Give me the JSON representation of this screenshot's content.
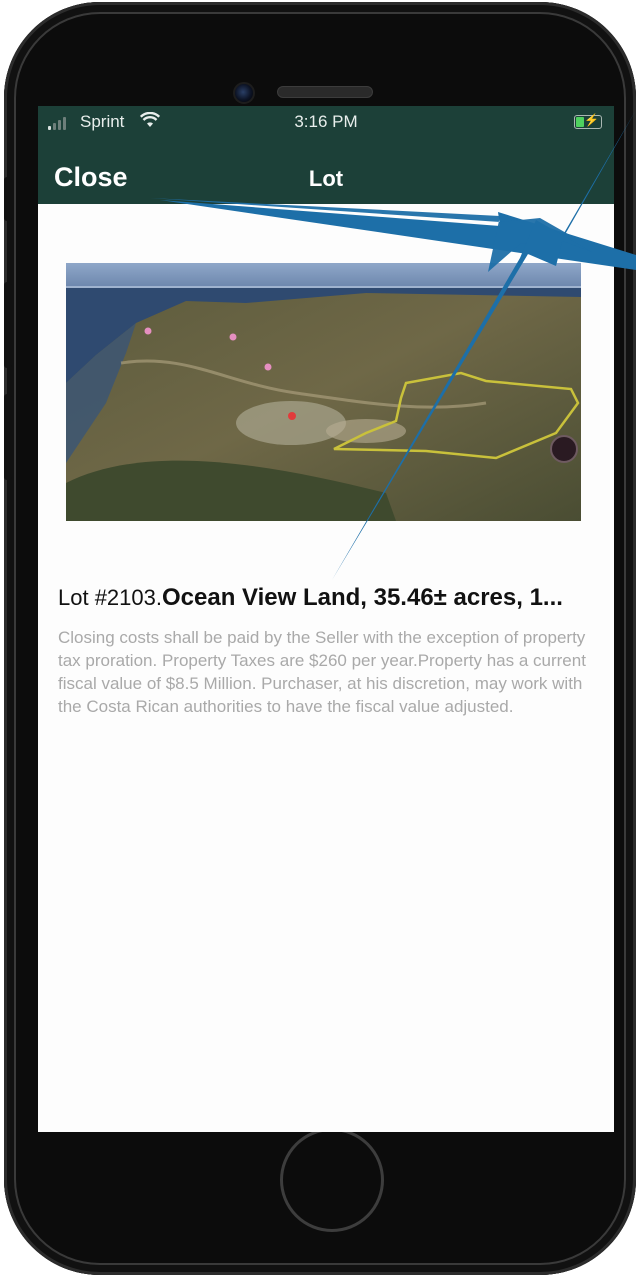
{
  "status_bar": {
    "carrier": "Sprint",
    "wifi_icon": "wifi-icon",
    "time": "3:16 PM",
    "battery_icon": "battery-charging-icon"
  },
  "nav": {
    "close_label": "Close",
    "title": "Lot"
  },
  "lot": {
    "image_icon": "aerial-map-image",
    "number": "Lot #2103.",
    "name": "Ocean View Land, 35.46± acres, 1...",
    "description": "Closing costs shall be paid by the Seller with the exception of property tax proration.  Property Taxes are $260 per year.Property has a current fiscal value of $8.5 Million. Purchaser, at his discretion, may work with the Costa Rican authorities to have the fiscal value adjusted."
  },
  "colors": {
    "header": "#1c4038",
    "annotation_arrow": "#1d6fa8",
    "description_text": "#a9a9a9"
  }
}
